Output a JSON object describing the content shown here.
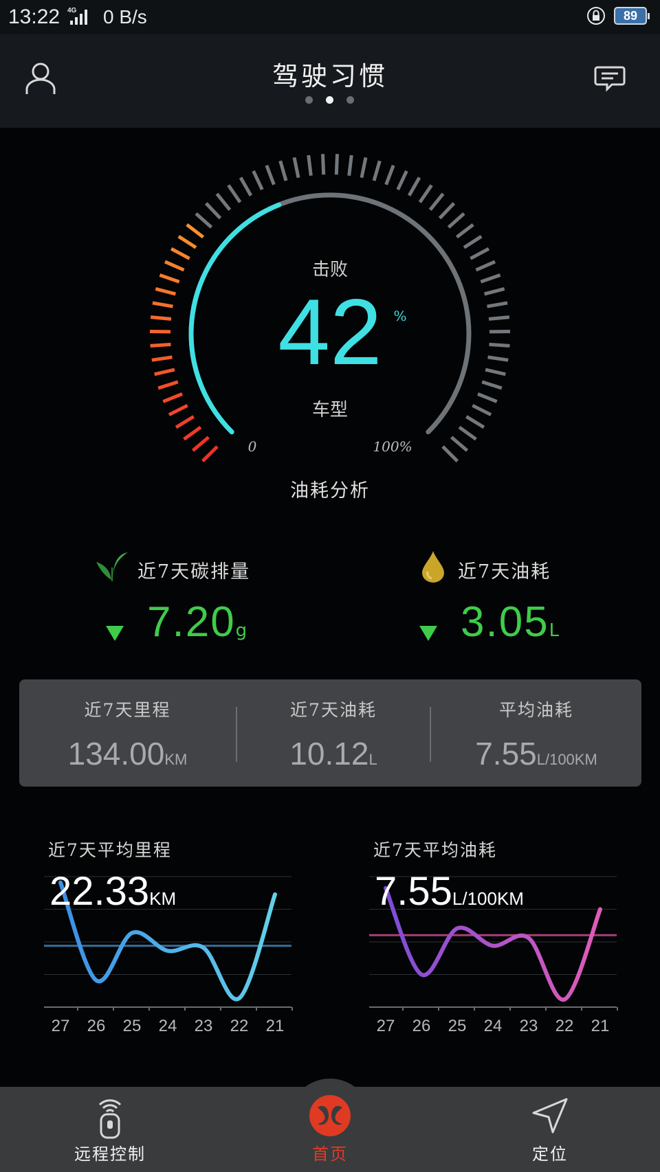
{
  "status_bar": {
    "time": "13:22",
    "network_type": "4G",
    "net_speed": "0 B/s",
    "battery": "89"
  },
  "header": {
    "title": "驾驶习惯",
    "page_indicator": {
      "count": 3,
      "active": 2
    }
  },
  "gauge": {
    "top_label": "击败",
    "value": "42",
    "unit": "%",
    "bottom_label": "车型",
    "min_label": "0",
    "max_label": "100%",
    "caption": "油耗分析",
    "percent": 42,
    "colors": {
      "accent": "#3fe0e3",
      "track": "#6e7378"
    }
  },
  "stats": {
    "carbon": {
      "label": "近7天碳排量",
      "value": "7.20",
      "unit": "g",
      "icon": "leaf-icon",
      "trend": "down"
    },
    "fuel": {
      "label": "近7天油耗",
      "value": "3.05",
      "unit": "L",
      "icon": "oil-drop-icon",
      "trend": "down"
    }
  },
  "summary": {
    "mileage": {
      "label": "近7天里程",
      "value": "134.00",
      "unit": "KM"
    },
    "fuel": {
      "label": "近7天油耗",
      "value": "10.12",
      "unit": "L"
    },
    "avg": {
      "label": "平均油耗",
      "value": "7.55",
      "unit": "L/100KM"
    }
  },
  "chart_data": [
    {
      "type": "line",
      "title": "近7天平均里程",
      "headline_value": "22.33",
      "headline_unit": "KM",
      "categories": [
        "27",
        "26",
        "25",
        "24",
        "23",
        "22",
        "21"
      ],
      "values": [
        33,
        16.5,
        24.5,
        21.5,
        22,
        13.5,
        31
      ],
      "average": 22.33,
      "ylim": [
        12,
        34
      ],
      "colors": {
        "start": "#3b8fe8",
        "end": "#63d0ea",
        "avg_line": "#3a6e9a"
      }
    },
    {
      "type": "line",
      "title": "近7天平均油耗",
      "headline_value": "7.55",
      "headline_unit": "L/100KM",
      "categories": [
        "27",
        "26",
        "25",
        "24",
        "23",
        "22",
        "21"
      ],
      "values": [
        10,
        5.5,
        7.9,
        7.0,
        7.4,
        4.2,
        8.9
      ],
      "average": 7.55,
      "ylim": [
        3.8,
        10.6
      ],
      "colors": {
        "start": "#7c4cd8",
        "end": "#e05cb8",
        "avg_line": "#a8407a"
      }
    }
  ],
  "tabbar": {
    "remote": {
      "label": "远程控制",
      "icon": "remote-key-icon"
    },
    "home": {
      "label": "首页",
      "icon": "brand-logo-icon"
    },
    "locate": {
      "label": "定位",
      "icon": "navigation-arrow-icon"
    }
  }
}
